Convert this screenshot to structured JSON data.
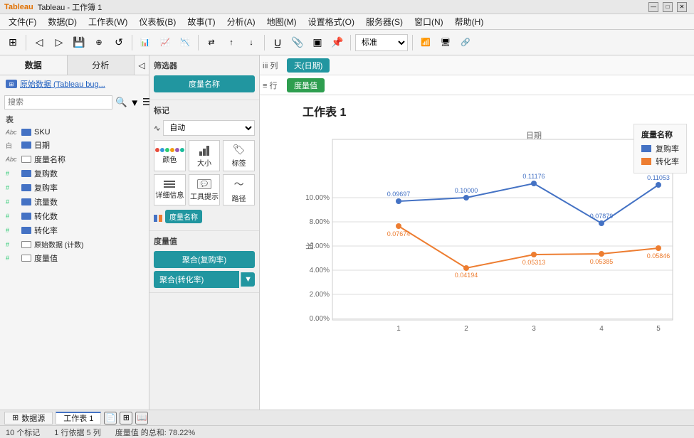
{
  "titlebar": {
    "logo": "Tableau",
    "title": "Tableau - 工作簿 1",
    "min": "—",
    "max": "□",
    "close": "✕"
  },
  "menubar": {
    "items": [
      {
        "label": "文件(F)"
      },
      {
        "label": "数据(D)"
      },
      {
        "label": "工作表(W)"
      },
      {
        "label": "仪表板(B)"
      },
      {
        "label": "故事(T)"
      },
      {
        "label": "分析(A)"
      },
      {
        "label": "地图(M)"
      },
      {
        "label": "设置格式(O)"
      },
      {
        "label": "服务器(S)"
      },
      {
        "label": "窗口(N)"
      },
      {
        "label": "帮助(H)"
      }
    ]
  },
  "toolbar": {
    "dropdown_label": "标准"
  },
  "left_panel": {
    "tab1": "数据",
    "tab2": "分析",
    "datasource": "原始数据 (Tableau bug...",
    "search_placeholder": "搜索",
    "section_table": "表",
    "fields": [
      {
        "type": "Abc",
        "name": "SKU",
        "icon": "abc"
      },
      {
        "type": "白",
        "name": "日期",
        "icon": "cal"
      },
      {
        "type": "Abc",
        "name": "度量名称",
        "icon": "abc"
      },
      {
        "type": "#",
        "name": "复购数",
        "icon": "hash"
      },
      {
        "type": "#",
        "name": "复购率",
        "icon": "hash"
      },
      {
        "type": "#",
        "name": "流量数",
        "icon": "hash"
      },
      {
        "type": "#",
        "name": "转化数",
        "icon": "hash"
      },
      {
        "type": "#",
        "name": "转化率",
        "icon": "hash"
      },
      {
        "type": "#",
        "name": "原始数据 (计数)",
        "icon": "hash"
      },
      {
        "type": "#",
        "name": "度量值",
        "icon": "hash"
      }
    ]
  },
  "mid_panel": {
    "filter_section": "筛选器",
    "filter_pill": "度量名称",
    "marks_section": "标记",
    "marks_auto": "自动",
    "marks_buttons": [
      {
        "label": "颜色"
      },
      {
        "label": "大小"
      },
      {
        "label": "标签"
      },
      {
        "label": "详细信息"
      },
      {
        "label": "工具提示"
      },
      {
        "label": "路径"
      }
    ],
    "marks_measure_pill": "度量名称",
    "measure_vals_section": "度量值",
    "measure_pills": [
      {
        "label": "聚合(复购率)"
      },
      {
        "label": "聚合(转化率)"
      }
    ]
  },
  "shelf": {
    "page_label": "iii 列",
    "row_label": "≡ 行",
    "col_pill": "天(日期)",
    "row_pill": "度量值"
  },
  "chart": {
    "title": "工作表 1",
    "y_label": "比",
    "x_axis_labels": [
      "1",
      "2",
      "3",
      "4",
      "5"
    ],
    "y_axis_labels": [
      "0.00%",
      "2.00%",
      "4.00%",
      "6.00%",
      "8.00%",
      "10.00%"
    ],
    "legend_title": "度量名称",
    "legend_items": [
      {
        "name": "复购率",
        "color": "#4472c4"
      },
      {
        "name": "转化率",
        "color": "#ed7d31"
      }
    ],
    "series": [
      {
        "name": "复购率",
        "color": "#4472c4",
        "points": [
          {
            "x": 1,
            "y": 0.09697,
            "label": "0.09697"
          },
          {
            "x": 2,
            "y": 0.1,
            "label": "0.10000"
          },
          {
            "x": 3,
            "y": 0.11176,
            "label": "0.11176"
          },
          {
            "x": 4,
            "y": 0.07879,
            "label": "0.07879"
          },
          {
            "x": 5,
            "y": 0.11053,
            "label": "0.11053"
          }
        ]
      },
      {
        "name": "转化率",
        "color": "#ed7d31",
        "points": [
          {
            "x": 1,
            "y": 0.07674,
            "label": "0.07674"
          },
          {
            "x": 2,
            "y": 0.04194,
            "label": "0.04194"
          },
          {
            "x": 3,
            "y": 0.05313,
            "label": "0.05313"
          },
          {
            "x": 4,
            "y": 0.05385,
            "label": "0.05385"
          },
          {
            "x": 5,
            "y": 0.05846,
            "label": "0.05846"
          }
        ]
      }
    ],
    "x_title": "日期",
    "x_title_x": 3
  },
  "bottom": {
    "datasource_tab": "数据源",
    "sheet_tab": "工作表 1",
    "new_sheet_icon": "+",
    "status_marks": "10 个标记",
    "status_rows": "1 行依据 5 列",
    "status_sum": "度量值 的总和: 78.22%"
  }
}
